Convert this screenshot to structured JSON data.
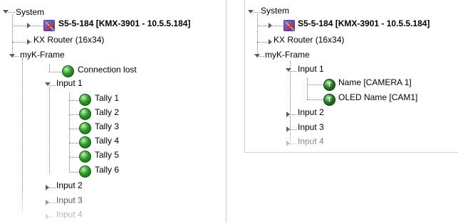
{
  "left_tree": {
    "system": "System",
    "device": "S5-5-184 [KMX-3901 - 10.5.5.184]",
    "router": "KX Router (16x34)",
    "frame": "myK-Frame",
    "connection": "Connection lost",
    "input1": "Input 1",
    "tallies": [
      "Tally 1",
      "Tally 2",
      "Tally 3",
      "Tally 4",
      "Tally 5",
      "Tally 6"
    ],
    "input2": "Input 2",
    "input3": "Input 3",
    "input4": "Input 4"
  },
  "right_tree": {
    "system": "System",
    "device": "S5-5-184 [KMX-3901 - 10.5.5.184]",
    "router": "KX Router (16x34)",
    "frame": "myK-Frame",
    "input1": "Input 1",
    "name_item": "Name [CAMERA 1]",
    "oled_item": "OLED Name [CAM1]",
    "input2": "Input 2",
    "input3": "Input 3",
    "input4": "Input 4",
    "t_icon_glyph": "T"
  },
  "colors": {
    "status_green": "#2f9b2a",
    "tree_line": "#7a7a7a"
  }
}
